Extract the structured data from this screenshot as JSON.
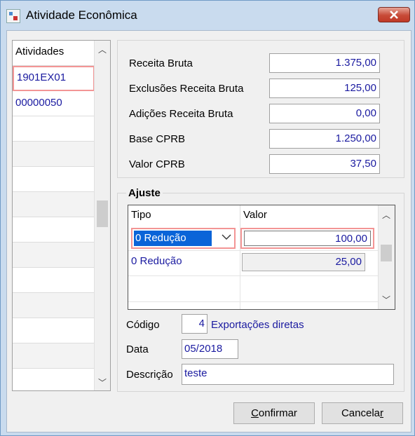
{
  "window": {
    "title": "Atividade Econômica"
  },
  "list": {
    "header": "Atividades",
    "items": [
      "1901EX01",
      "00000050"
    ]
  },
  "summary": {
    "receita_bruta_label": "Receita Bruta",
    "receita_bruta_value": "1.375,00",
    "exclusoes_label": "Exclusões Receita Bruta",
    "exclusoes_value": "125,00",
    "adicoes_label": "Adições Receita Bruta",
    "adicoes_value": "0,00",
    "base_label": "Base CPRB",
    "base_value": "1.250,00",
    "valor_label": "Valor CPRB",
    "valor_value": "37,50"
  },
  "ajuste": {
    "title": "Ajuste",
    "col_tipo": "Tipo",
    "col_valor": "Valor",
    "rows": [
      {
        "tipo": "0 Redução",
        "valor": "100,00"
      },
      {
        "tipo": "0 Redução",
        "valor": "25,00"
      }
    ]
  },
  "form": {
    "codigo_label": "Código",
    "codigo_value": "4",
    "codigo_desc": "Exportações diretas",
    "data_label": "Data",
    "data_value": "05/2018",
    "descricao_label": "Descrição",
    "descricao_value": "teste"
  },
  "buttons": {
    "confirmar_first": "C",
    "confirmar_rest": "onfirmar",
    "cancelar_main": "Cancela",
    "cancelar_u": "r"
  },
  "colors": {
    "accent_text": "#1a1aa0",
    "highlight_border": "#f39595",
    "selection": "#0a64d8"
  }
}
